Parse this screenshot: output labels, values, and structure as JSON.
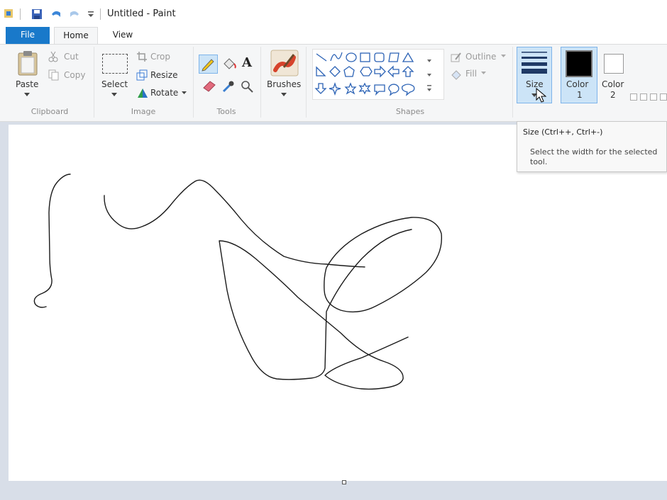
{
  "window": {
    "title": "Untitled - Paint"
  },
  "tabs": {
    "file": "File",
    "home": "Home",
    "view": "View"
  },
  "clipboard": {
    "paste": "Paste",
    "cut": "Cut",
    "copy": "Copy",
    "group": "Clipboard"
  },
  "image": {
    "select": "Select",
    "crop": "Crop",
    "resize": "Resize",
    "rotate": "Rotate",
    "group": "Image"
  },
  "tools": {
    "text_glyph": "A",
    "group": "Tools"
  },
  "brushes": {
    "label": "Brushes"
  },
  "shapes": {
    "outline": "Outline",
    "fill": "Fill",
    "group": "Shapes"
  },
  "size": {
    "label": "Size"
  },
  "colors": {
    "color1": "Color",
    "color1_num": "1",
    "color2": "Color",
    "color2_num": "2",
    "color1_value": "#000000",
    "color2_value": "#ffffff"
  },
  "tooltip": {
    "title": "Size (Ctrl++, Ctrl+-)",
    "line1": "Select the width for the selected",
    "line2": "tool."
  },
  "accent": "#1979ca"
}
